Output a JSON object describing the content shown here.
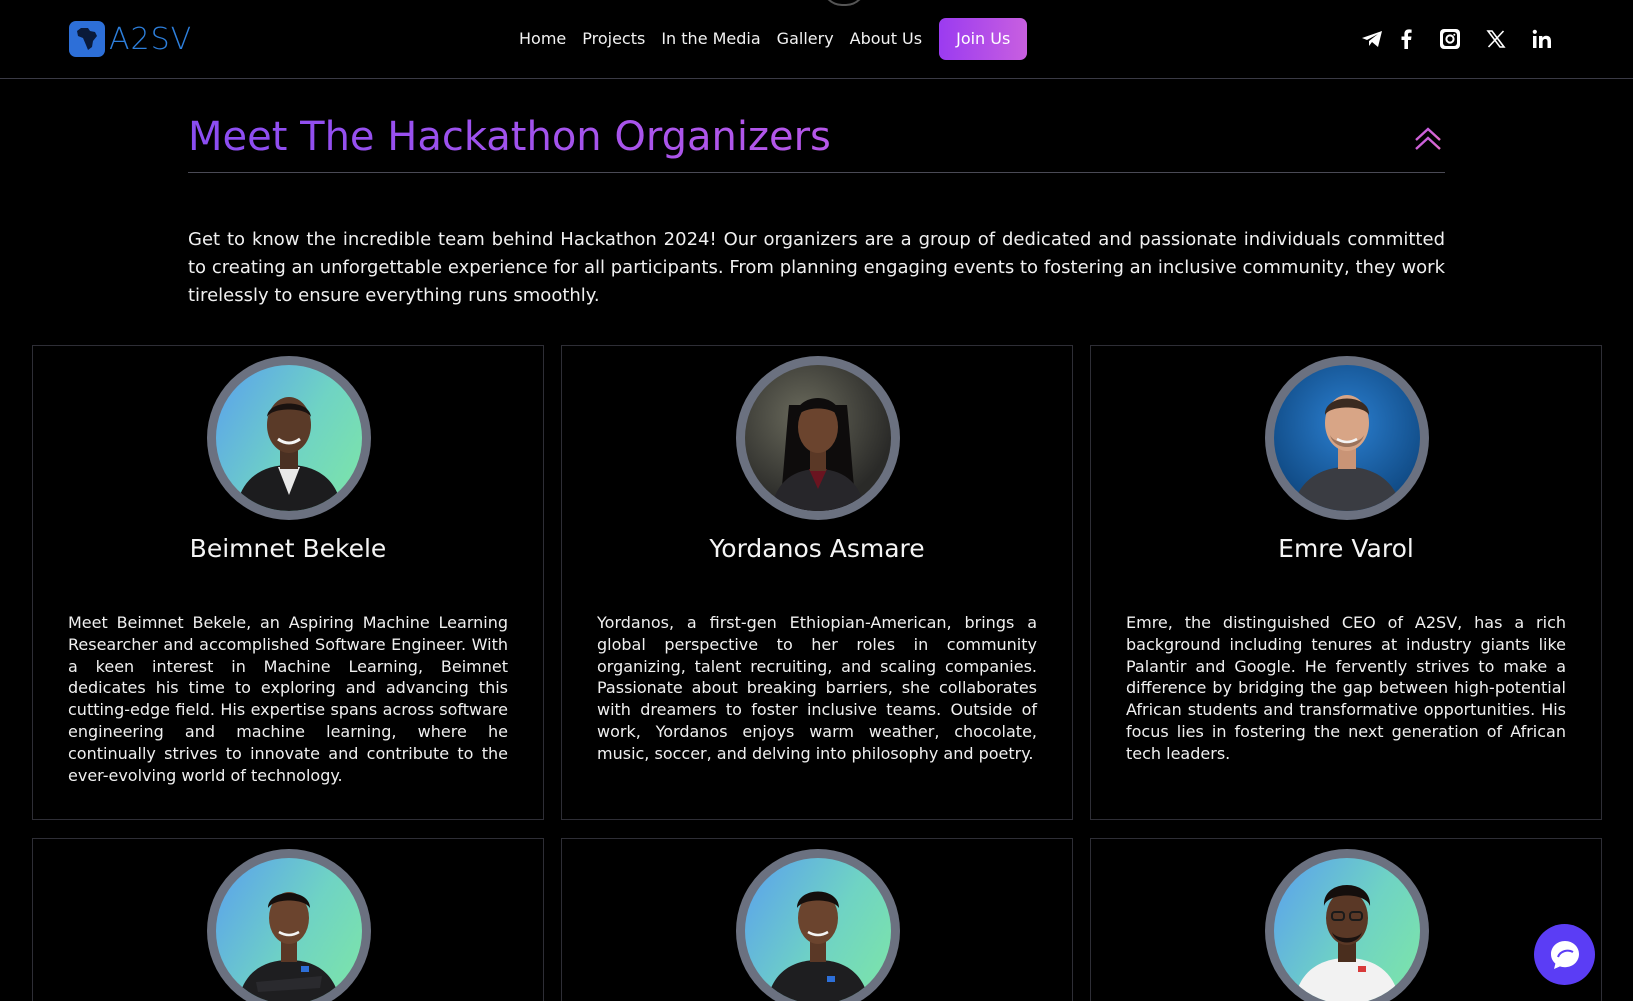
{
  "header": {
    "logo_text": "A2SV",
    "nav": [
      {
        "label": "Home"
      },
      {
        "label": "Projects"
      },
      {
        "label": "In the Media"
      },
      {
        "label": "Gallery"
      },
      {
        "label": "About Us"
      }
    ],
    "cta_label": "Join Us",
    "socials": [
      "telegram-icon",
      "facebook-icon",
      "instagram-icon",
      "x-icon",
      "linkedin-icon"
    ]
  },
  "section": {
    "title": "Meet The Hackathon Organizers",
    "intro": "Get to know the incredible team behind Hackathon 2024! Our organizers are a group of dedicated and passionate individuals committed to creating an unforgettable experience for all participants. From planning engaging events to fostering an inclusive community, they work tirelessly to ensure everything runs smoothly."
  },
  "organizers": [
    {
      "name": "Beimnet Bekele",
      "bio": "Meet Beimnet Bekele, an Aspiring Machine Learning Researcher and accomplished Software Engineer. With a keen interest in Machine Learning, Beimnet dedicates his time to exploring and advancing this cutting-edge field. His expertise spans across software engineering and machine learning, where he continually strives to innovate and contribute to the ever-evolving world of technology."
    },
    {
      "name": "Yordanos Asmare",
      "bio": "Yordanos, a first-gen Ethiopian-American, brings a global perspective to her roles in community organizing, talent recruiting, and scaling companies. Passionate about breaking barriers, she collaborates with dreamers to foster inclusive teams. Outside of work, Yordanos enjoys warm weather, chocolate, music, soccer, and delving into philosophy and poetry."
    },
    {
      "name": "Emre Varol",
      "bio": "Emre, the distinguished CEO of A2SV, has a rich background including tenures at industry giants like Palantir and Google. He fervently strives to make a difference by bridging the gap between high-potential African students and transformative opportunities. His focus lies in fostering the next generation of African tech leaders."
    }
  ],
  "colors": {
    "brand_blue": "#2d7fdc",
    "cta_start": "#9b3bf0",
    "cta_end": "#c85fe0",
    "title_gradient_start": "#8a4df2",
    "title_gradient_end": "#e06cc8",
    "chat_button": "#5b3df5"
  }
}
